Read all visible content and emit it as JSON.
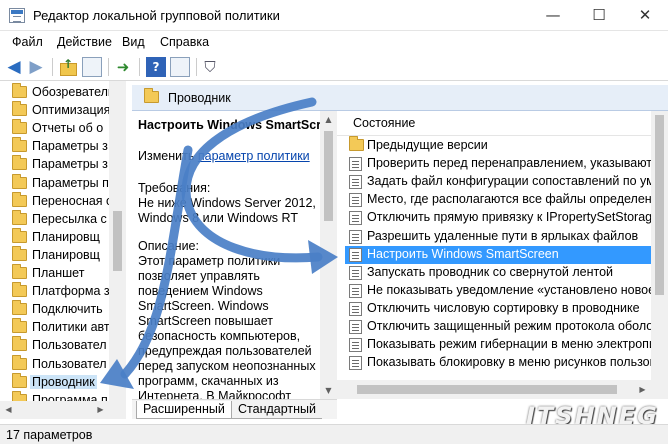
{
  "window": {
    "title": "Редактор локальной групповой политики",
    "minimize_glyph": "—",
    "maximize_glyph": "☐",
    "close_glyph": "✕"
  },
  "menu": {
    "file": "Файл",
    "action": "Действие",
    "view": "Вид",
    "help": "Справка"
  },
  "toolbar": {
    "back_icon": "arrow-left-icon",
    "forward_icon": "arrow-right-icon",
    "help_glyph": "?"
  },
  "tree": {
    "items": [
      "Обозреватель",
      "Оптимизация",
      "Отчеты об о",
      "Параметры з",
      "Параметры з",
      "Параметры п",
      "Переносная о",
      "Пересылка с",
      "Планировщ",
      "Планировщ",
      "Планшет",
      "Платформа з",
      "Подключить",
      "Политики авт",
      "Пользовател",
      "Пользовател",
      "Проводник",
      "Программа п"
    ],
    "selected_index": 16
  },
  "header": {
    "title": "Проводник"
  },
  "description": {
    "policy_title": "Настроить Windows SmartScreen",
    "edit_prefix": "Изменить",
    "edit_link": "параметр политики",
    "requirements_label": "Требования:",
    "requirements_text": "Не ниже Windows Server 2012, Windows 8 или Windows RT",
    "description_label": "Описание:",
    "description_text": "Этот параметр политики позволяет управлять поведением Windows SmartScreen. Windows SmartScreen повышает безопасность компьютеров, предупреждая пользователей перед запуском неопознанных программ, скачанных из Интернета. В Майкрософт"
  },
  "list": {
    "column_header": "Состояние",
    "rows": [
      {
        "label": "Предыдущие версии",
        "type": "folder"
      },
      {
        "label": "Проверить перед перенаправлением, указывают л",
        "type": "setting"
      },
      {
        "label": "Задать файл конфигурации сопоставлений по умо",
        "type": "setting"
      },
      {
        "label": "Место, где располагаются все файлы определения",
        "type": "setting"
      },
      {
        "label": "Отключить прямую привязку к IPropertySetStorage",
        "type": "setting"
      },
      {
        "label": "Разрешить удаленные пути в ярлыках файлов",
        "type": "setting"
      },
      {
        "label": "Настроить Windows SmartScreen",
        "type": "setting"
      },
      {
        "label": "Запускать проводник со свернутой лентой",
        "type": "setting"
      },
      {
        "label": "Не показывать уведомление «установлено новое п",
        "type": "setting"
      },
      {
        "label": "Отключить числовую сортировку в проводнике",
        "type": "setting"
      },
      {
        "label": "Отключить защищенный режим протокола оболо",
        "type": "setting"
      },
      {
        "label": "Показывать режим гибернации в меню электропи",
        "type": "setting"
      },
      {
        "label": "Показывать блокировку в меню рисунков пользов",
        "type": "setting"
      }
    ],
    "selected_index": 6
  },
  "tabs": {
    "extended": "Расширенный",
    "standard": "Стандартный"
  },
  "status": {
    "text": "17 параметров"
  },
  "watermark": "ITSHNEG",
  "colors": {
    "selection": "#3399ff",
    "tree_selection": "#cce4f7",
    "annotation_arrow": "#4a7fc7",
    "header_bar": "#e6eef8"
  }
}
